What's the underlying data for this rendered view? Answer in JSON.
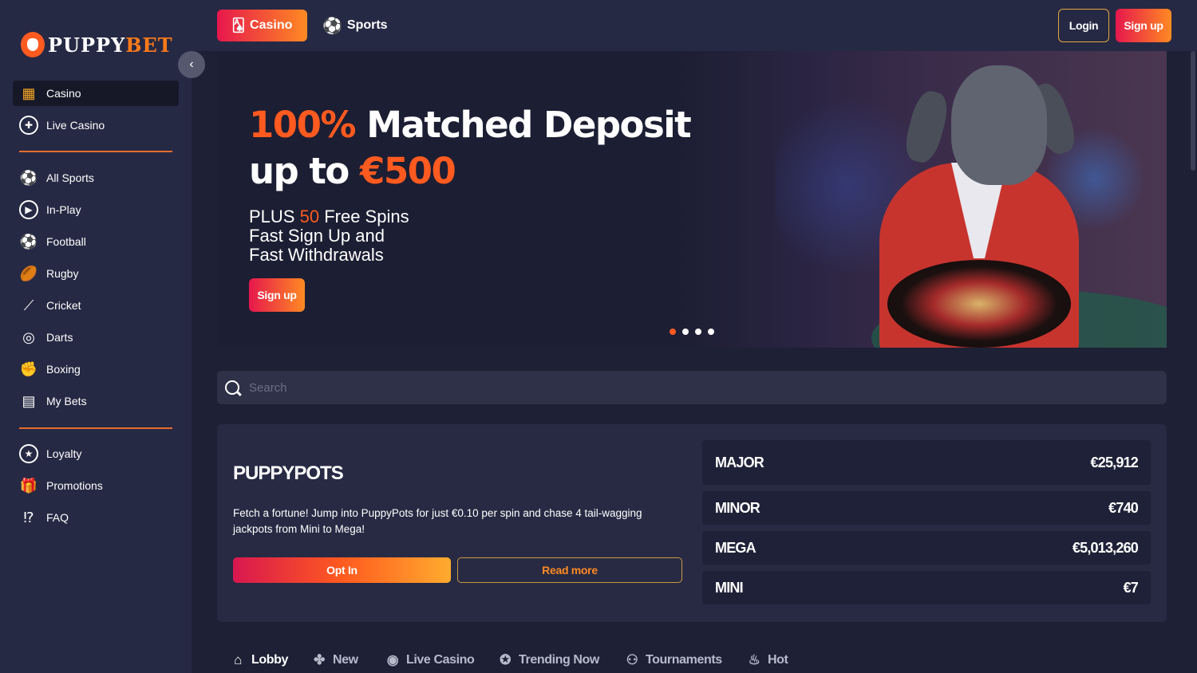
{
  "brand": {
    "name_part1": "PUPPY",
    "name_part2": "BET"
  },
  "sidebar": {
    "casino_items": [
      {
        "label": "Casino",
        "icon": "slot-machine-icon"
      },
      {
        "label": "Live Casino",
        "icon": "poker-chip-icon"
      }
    ],
    "sports_items": [
      {
        "label": "All Sports",
        "icon": "sports-balls-icon"
      },
      {
        "label": "In-Play",
        "icon": "play-icon"
      },
      {
        "label": "Football",
        "icon": "football-icon"
      },
      {
        "label": "Rugby",
        "icon": "rugby-ball-icon"
      },
      {
        "label": "Cricket",
        "icon": "cricket-bat-icon"
      },
      {
        "label": "Darts",
        "icon": "dartboard-icon"
      },
      {
        "label": "Boxing",
        "icon": "boxing-glove-icon"
      },
      {
        "label": "My Bets",
        "icon": "bets-icon"
      }
    ],
    "extra_items": [
      {
        "label": "Loyalty",
        "icon": "star-icon"
      },
      {
        "label": "Promotions",
        "icon": "gift-icon"
      },
      {
        "label": "FAQ",
        "icon": "question-icon"
      }
    ]
  },
  "topbar": {
    "tabs": [
      {
        "label": "Casino"
      },
      {
        "label": "Sports"
      }
    ],
    "login_label": "Login",
    "signup_label": "Sign up"
  },
  "hero": {
    "headline_highlight": "100%",
    "headline_rest": " Matched Deposit",
    "headline_line2_prefix": "up to ",
    "headline_line2_highlight": "€500",
    "sub_line1_prefix": "PLUS ",
    "sub_line1_highlight": "50",
    "sub_line1_suffix": " Free Spins",
    "sub_line2": "Fast Sign Up and",
    "sub_line3": "Fast Withdrawals",
    "cta_label": "Sign up",
    "slide_count": 4,
    "active_slide": 1
  },
  "search": {
    "placeholder": "Search"
  },
  "puppypots": {
    "title": "PUPPYPOTS",
    "description": "Fetch a fortune! Jump into PuppyPots for just €0.10 per spin and chase 4 tail-wagging jackpots from Mini to Mega!",
    "optin_label": "Opt In",
    "readmore_label": "Read more",
    "jackpots": [
      {
        "name": "MAJOR",
        "amount": "€25,912"
      },
      {
        "name": "MINOR",
        "amount": "€740"
      },
      {
        "name": "MEGA",
        "amount": "€5,013,260"
      },
      {
        "name": "MINI",
        "amount": "€7"
      }
    ]
  },
  "categories": [
    {
      "label": "Lobby",
      "icon": "home-icon"
    },
    {
      "label": "New",
      "icon": "new-icon"
    },
    {
      "label": "Live Casino",
      "icon": "live-chip-icon"
    },
    {
      "label": "Trending Now",
      "icon": "trending-star-icon"
    },
    {
      "label": "Tournaments",
      "icon": "tournament-icon"
    },
    {
      "label": "Hot",
      "icon": "hot-icon"
    }
  ],
  "colors": {
    "accent_orange": "#ff5a1f",
    "gradient_start": "#e6174d",
    "gradient_end": "#ff8a22",
    "background": "#1e2035",
    "sidebar": "#262944"
  }
}
